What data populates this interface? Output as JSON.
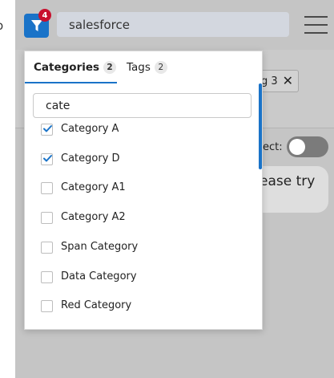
{
  "header": {
    "filter_badge_count": "4",
    "search_value": "salesforce"
  },
  "background": {
    "chip_text": "g 3",
    "toggle_label": "ect:",
    "message_text": "ease try",
    "toggle_on": false
  },
  "dropdown": {
    "tabs": [
      {
        "label": "Categories",
        "count": "2",
        "active": true
      },
      {
        "label": "Tags",
        "count": "2",
        "active": false
      }
    ],
    "filter_input_value": "cate",
    "items": [
      {
        "label": "Category A",
        "checked": true
      },
      {
        "label": "Category D",
        "checked": true
      },
      {
        "label": "Category A1",
        "checked": false
      },
      {
        "label": "Category A2",
        "checked": false
      },
      {
        "label": "Span Category",
        "checked": false
      },
      {
        "label": "Data Category",
        "checked": false
      },
      {
        "label": "Red Category",
        "checked": false
      }
    ]
  },
  "colors": {
    "accent": "#1a73c8",
    "badge": "#c8102e"
  }
}
